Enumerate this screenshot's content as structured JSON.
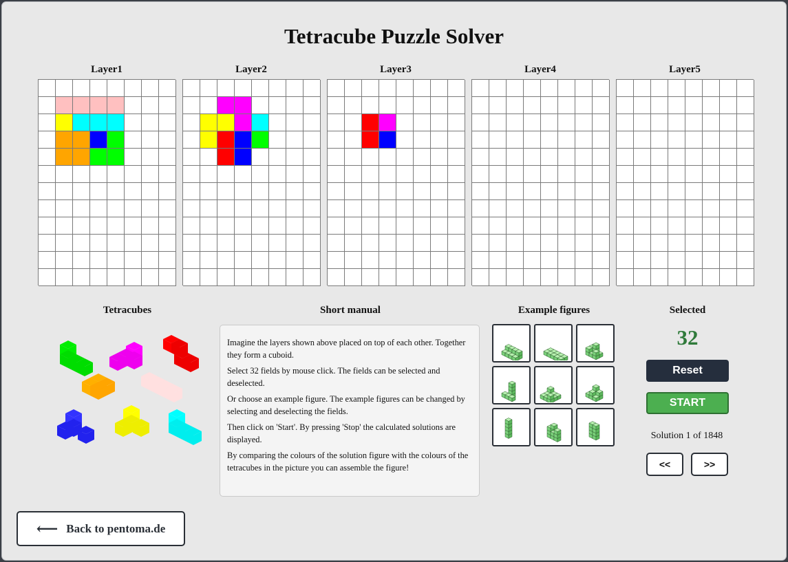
{
  "title": "Tetracube Puzzle Solver",
  "colors": {
    "pink": "#ffc0c0",
    "yellow": "#ffff00",
    "cyan": "#00ffff",
    "orange": "#ffa500",
    "blue": "#0000ff",
    "green": "#00ff00",
    "magenta": "#ff00ff",
    "red": "#ff0000",
    "example_green": "#90e090"
  },
  "layers": [
    {
      "title": "Layer1",
      "cells": [
        [
          1,
          1,
          "pink"
        ],
        [
          1,
          2,
          "pink"
        ],
        [
          1,
          3,
          "pink"
        ],
        [
          1,
          4,
          "pink"
        ],
        [
          2,
          1,
          "yellow"
        ],
        [
          2,
          2,
          "cyan"
        ],
        [
          2,
          3,
          "cyan"
        ],
        [
          2,
          4,
          "cyan"
        ],
        [
          3,
          1,
          "orange"
        ],
        [
          3,
          2,
          "orange"
        ],
        [
          3,
          3,
          "blue"
        ],
        [
          3,
          4,
          "green"
        ],
        [
          4,
          1,
          "orange"
        ],
        [
          4,
          2,
          "orange"
        ],
        [
          4,
          3,
          "green"
        ],
        [
          4,
          4,
          "green"
        ]
      ]
    },
    {
      "title": "Layer2",
      "cells": [
        [
          1,
          2,
          "magenta"
        ],
        [
          1,
          3,
          "magenta"
        ],
        [
          2,
          1,
          "yellow"
        ],
        [
          2,
          2,
          "yellow"
        ],
        [
          2,
          3,
          "magenta"
        ],
        [
          2,
          4,
          "cyan"
        ],
        [
          3,
          1,
          "yellow"
        ],
        [
          3,
          2,
          "red"
        ],
        [
          3,
          3,
          "blue"
        ],
        [
          3,
          4,
          "green"
        ],
        [
          4,
          2,
          "red"
        ],
        [
          4,
          3,
          "blue"
        ]
      ]
    },
    {
      "title": "Layer3",
      "cells": [
        [
          2,
          2,
          "red"
        ],
        [
          2,
          3,
          "magenta"
        ],
        [
          3,
          2,
          "red"
        ],
        [
          3,
          3,
          "blue"
        ]
      ]
    },
    {
      "title": "Layer4",
      "cells": []
    },
    {
      "title": "Layer5",
      "cells": []
    }
  ],
  "tetracubes": {
    "title": "Tetracubes",
    "pieces": [
      "green-piece-icon",
      "magenta-piece-icon",
      "red-piece-icon",
      "orange-piece-icon",
      "pink-piece-icon",
      "blue-piece-icon",
      "yellow-piece-icon",
      "cyan-piece-icon"
    ]
  },
  "manual": {
    "title": "Short manual",
    "paragraphs": [
      "Imagine the layers shown above placed on top of each other. Together they form a cuboid.",
      "Select 32 fields by mouse click. The fields can be selected and deselected.",
      "Or choose an example figure. The example figures can be changed by selecting and deselecting the fields.",
      "Then click on 'Start'. By pressing 'Stop' the calculated solutions are displayed.",
      "By comparing the colours of the solution figure with the colours of the tetracubes in the picture you can assemble the figure!"
    ]
  },
  "examples": {
    "title": "Example figures",
    "icons": [
      "flat-slab-figure-icon",
      "long-slab-figure-icon",
      "step-figure-icon",
      "tower-base-figure-icon",
      "ring-figure-icon",
      "pyramid-figure-icon",
      "column-figure-icon",
      "castle-figure-icon",
      "double-column-figure-icon"
    ]
  },
  "selected": {
    "title": "Selected",
    "count": "32",
    "reset_label": "Reset",
    "start_label": "START",
    "solution_text": "Solution 1 of 1848",
    "prev_label": "<<",
    "next_label": ">>"
  },
  "back": {
    "label": "Back to pentoma.de",
    "arrow": "⟵"
  }
}
